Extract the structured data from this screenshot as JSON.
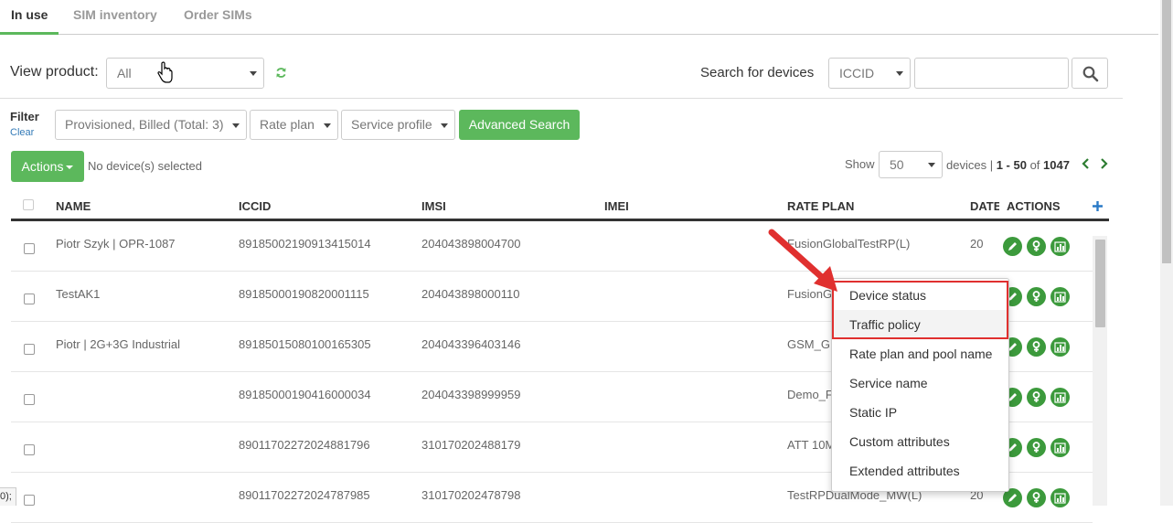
{
  "tabs": [
    {
      "label": "In use",
      "active": true
    },
    {
      "label": "SIM inventory",
      "active": false
    },
    {
      "label": "Order SIMs",
      "active": false
    }
  ],
  "toolbar": {
    "view_product_label": "View product:",
    "product_value": "All",
    "search_label": "Search for devices",
    "search_field": "ICCID",
    "search_value": ""
  },
  "filter": {
    "label": "Filter",
    "clear": "Clear",
    "status": "Provisioned, Billed (Total: 3)",
    "rate_plan": "Rate plan",
    "service_profile": "Service profile",
    "advanced_search": "Advanced Search"
  },
  "actions": {
    "label": "Actions",
    "selection_text": "No device(s) selected",
    "show_label": "Show",
    "page_size": "50",
    "devices_label": "devices |",
    "range": "1 - 50",
    "of_label": "of",
    "total": "1047"
  },
  "columns": {
    "name": "NAME",
    "iccid": "ICCID",
    "imsi": "IMSI",
    "imei": "IMEI",
    "rate_plan": "RATE PLAN",
    "date": "DATE",
    "actions": "ACTIONS"
  },
  "rows": [
    {
      "name": "Piotr Szyk | OPR-1087",
      "iccid": "89185002190913415014",
      "imsi": "204043898004700",
      "imei": "",
      "rate_plan": "FusionGlobalTestRP(L)",
      "date": "20"
    },
    {
      "name": "TestAK1",
      "iccid": "89185000190820001115",
      "imsi": "204043898000110",
      "imei": "",
      "rate_plan": "FusionG",
      "date": ""
    },
    {
      "name": "Piotr | 2G+3G Industrial",
      "iccid": "89185015080100165305",
      "imsi": "204043396403146",
      "imei": "",
      "rate_plan": "GSM_GL",
      "date": ""
    },
    {
      "name": "",
      "iccid": "89185000190416000034",
      "imsi": "204043398999959",
      "imei": "",
      "rate_plan": "Demo_F",
      "date": ""
    },
    {
      "name": "",
      "iccid": "89011702272024881796",
      "imsi": "310170202488179",
      "imei": "",
      "rate_plan": "ATT 10M",
      "date": ""
    },
    {
      "name": "",
      "iccid": "89011702272024787985",
      "imsi": "310170202478798",
      "imei": "",
      "rate_plan": "TestRPDualMode_MW(L)",
      "date": "20"
    }
  ],
  "context_menu": {
    "items": [
      "Device status",
      "Traffic policy",
      "Rate plan and pool name",
      "Service name",
      "Static IP",
      "Custom attributes",
      "Extended attributes"
    ]
  },
  "status_snippet": "0);",
  "colors": {
    "accent": "#5cb85c",
    "highlight": "#e0302f",
    "link": "#337ab7"
  }
}
